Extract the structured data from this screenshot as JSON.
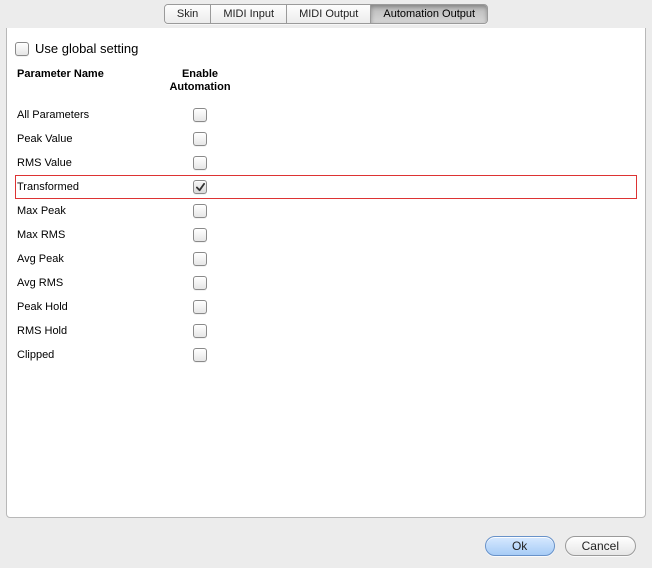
{
  "tabs": [
    {
      "label": "Skin",
      "active": false
    },
    {
      "label": "MIDI Input",
      "active": false
    },
    {
      "label": "MIDI Output",
      "active": false
    },
    {
      "label": "Automation Output",
      "active": true
    }
  ],
  "global": {
    "checked": false,
    "label": "Use global setting"
  },
  "headers": {
    "name": "Parameter Name",
    "enable_line1": "Enable",
    "enable_line2": "Automation"
  },
  "parameters": [
    {
      "name": "All Parameters",
      "checked": false,
      "highlight": false
    },
    {
      "name": "Peak Value",
      "checked": false,
      "highlight": false
    },
    {
      "name": "RMS Value",
      "checked": false,
      "highlight": false
    },
    {
      "name": "Transformed",
      "checked": true,
      "highlight": true
    },
    {
      "name": "Max Peak",
      "checked": false,
      "highlight": false
    },
    {
      "name": "Max RMS",
      "checked": false,
      "highlight": false
    },
    {
      "name": "Avg Peak",
      "checked": false,
      "highlight": false
    },
    {
      "name": "Avg RMS",
      "checked": false,
      "highlight": false
    },
    {
      "name": "Peak Hold",
      "checked": false,
      "highlight": false
    },
    {
      "name": "RMS Hold",
      "checked": false,
      "highlight": false
    },
    {
      "name": "Clipped",
      "checked": false,
      "highlight": false
    }
  ],
  "buttons": {
    "ok": "Ok",
    "cancel": "Cancel"
  }
}
